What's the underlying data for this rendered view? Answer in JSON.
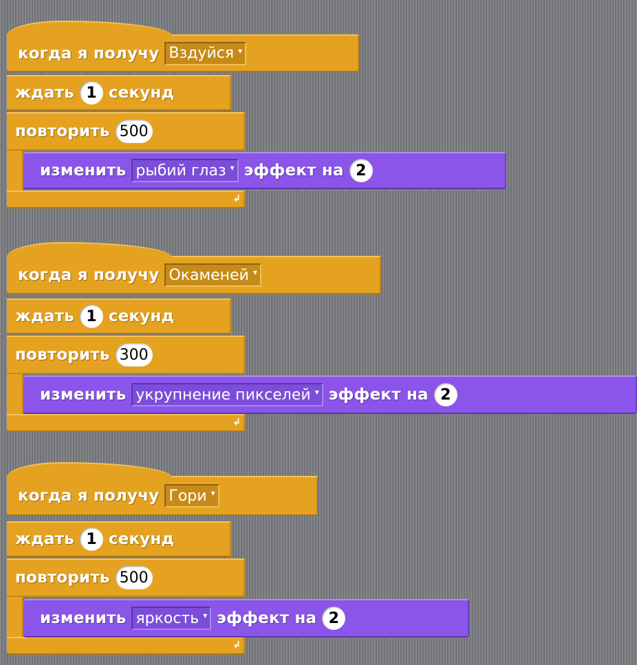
{
  "scripts": [
    {
      "when_label": "когда я получу",
      "message": "Вздуйся",
      "wait_label": "ждать",
      "wait_value": "1",
      "seconds_label": "секунд",
      "repeat_label": "повторить",
      "repeat_value": "500",
      "change_label": "изменить",
      "effect": "рыбий глаз",
      "effect_by_label": "эффект на",
      "effect_value": "2"
    },
    {
      "when_label": "когда я получу",
      "message": "Окаменей",
      "wait_label": "ждать",
      "wait_value": "1",
      "seconds_label": "секунд",
      "repeat_label": "повторить",
      "repeat_value": "300",
      "change_label": "изменить",
      "effect": "укрупнение пикселей",
      "effect_by_label": "эффект на",
      "effect_value": "2"
    },
    {
      "when_label": "когда я получу",
      "message": "Гори",
      "wait_label": "ждать",
      "wait_value": "1",
      "seconds_label": "секунд",
      "repeat_label": "повторить",
      "repeat_value": "500",
      "change_label": "изменить",
      "effect": "яркость",
      "effect_by_label": "эффект на",
      "effect_value": "2"
    }
  ],
  "icons": {
    "dropdown_caret": "▾",
    "loop_arrow": "↲"
  },
  "colors": {
    "control": "#e5a221",
    "looks": "#8a55e8",
    "workspace": "#7b7c80"
  }
}
